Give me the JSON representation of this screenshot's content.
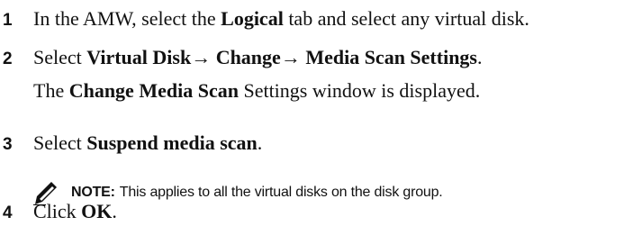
{
  "steps": [
    {
      "num": "1",
      "pre": "In the AMW, select the ",
      "bold": "Logical",
      "post": " tab and select any virtual disk."
    },
    {
      "num": "2",
      "pre": "Select ",
      "bold1": "Virtual Disk",
      "arrow1": "→",
      "bold2": " Change",
      "arrow2": "→",
      "bold3": " Media Scan Settings",
      "post": "."
    },
    {
      "num": "3",
      "pre": "Select ",
      "bold": "Suspend media scan",
      "post": "."
    },
    {
      "num": "4",
      "pre": "Click ",
      "bold": "OK",
      "post": "."
    }
  ],
  "step2_detail": {
    "pre": "The ",
    "bold": "Change Media Scan",
    "post": " Settings window is displayed."
  },
  "note": {
    "label": "NOTE:",
    "text": "This applies to all the virtual disks on the disk group.",
    "icon": "pencil-note-icon"
  }
}
